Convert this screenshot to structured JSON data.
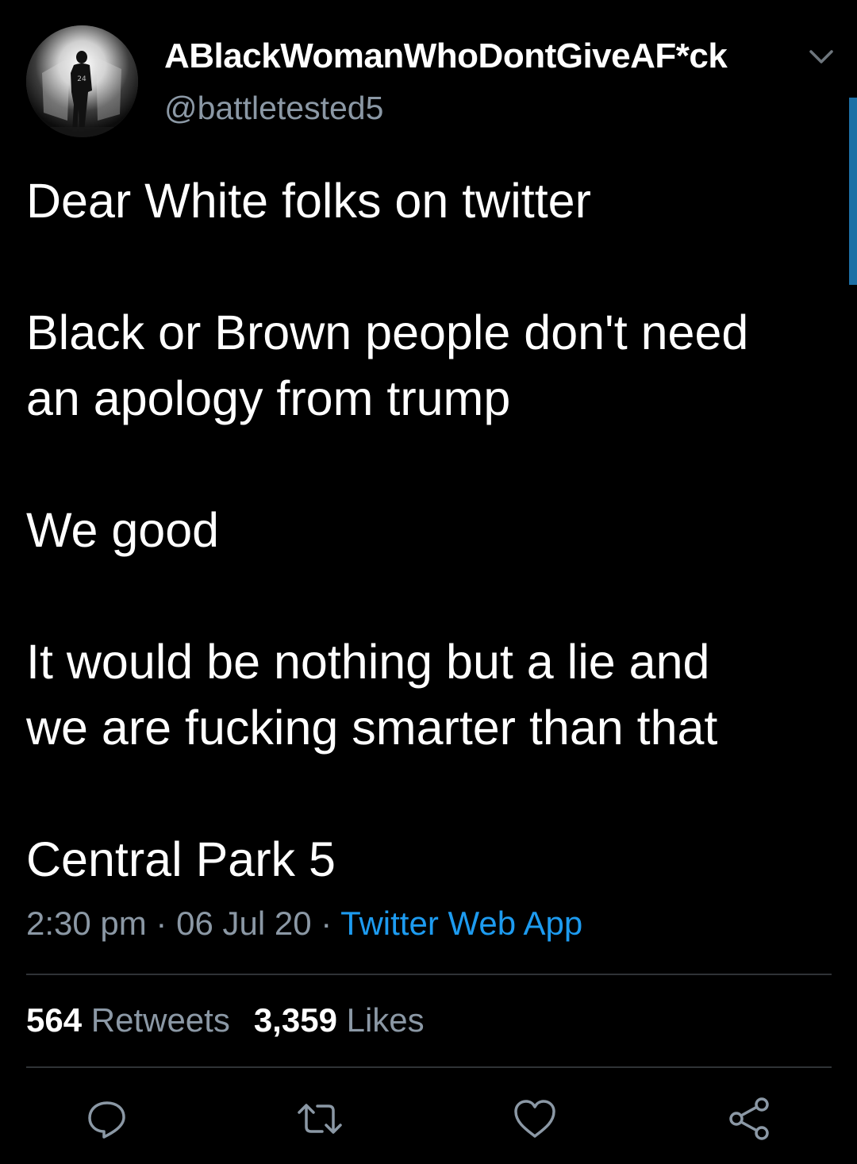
{
  "author": {
    "display_name": "ABlackWomanWhoDontGiveAF*ck",
    "handle": "@battletested5",
    "avatar_icon": "profile-photo-silhouette-24"
  },
  "tweet": {
    "paragraphs": [
      "Dear White folks on twitter",
      "Black or Brown people don't need\nan apology from trump",
      "We good",
      "It would be nothing but a lie and\nwe are fucking smarter than that",
      "Central Park 5"
    ]
  },
  "meta": {
    "time": "2:30 pm",
    "separator": " · ",
    "date": "06 Jul 20",
    "source": "Twitter Web App"
  },
  "stats": {
    "retweets_count": "564",
    "retweets_label": "Retweets",
    "likes_count": "3,359",
    "likes_label": "Likes"
  },
  "actions": [
    "reply-icon",
    "retweet-icon",
    "like-icon",
    "share-icon"
  ],
  "colors": {
    "background": "#000000",
    "text": "#ffffff",
    "secondary_text": "#8b98a5",
    "link": "#1d9bf0",
    "divider": "#2f3336",
    "scroll_indicator": "#1d6fa5"
  }
}
